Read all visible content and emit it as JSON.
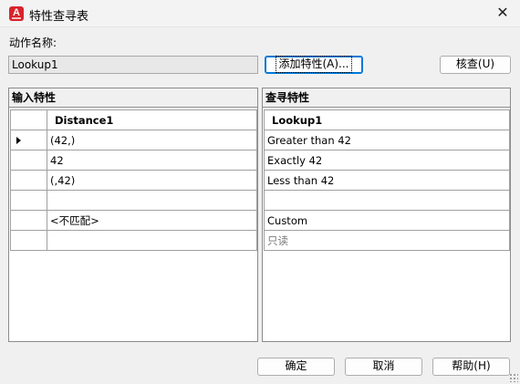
{
  "window": {
    "title": "特性查寻表",
    "close_glyph": "✕"
  },
  "action_name": {
    "label": "动作名称:",
    "value": "Lookup1"
  },
  "buttons": {
    "add_property": "添加特性(A)...",
    "audit": "核查(U)",
    "ok": "确定",
    "cancel": "取消",
    "help": "帮助(H)"
  },
  "input_panel": {
    "title": "输入特性",
    "column_header": "Distance1",
    "rows": [
      "(42,)",
      "42",
      "(,42)",
      "",
      "<不匹配>",
      ""
    ]
  },
  "lookup_panel": {
    "title": "查寻特性",
    "column_header": "Lookup1",
    "rows": [
      "Greater than 42",
      "Exactly 42",
      "Less than 42",
      "",
      "Custom",
      "只读"
    ]
  },
  "colors": {
    "app_icon": "#d9242c",
    "focus_border": "#0078d7"
  },
  "icons": {
    "app": "autocad-a-icon",
    "row_pointer": "triangle-right-icon",
    "resize": "resize-grip-icon"
  }
}
